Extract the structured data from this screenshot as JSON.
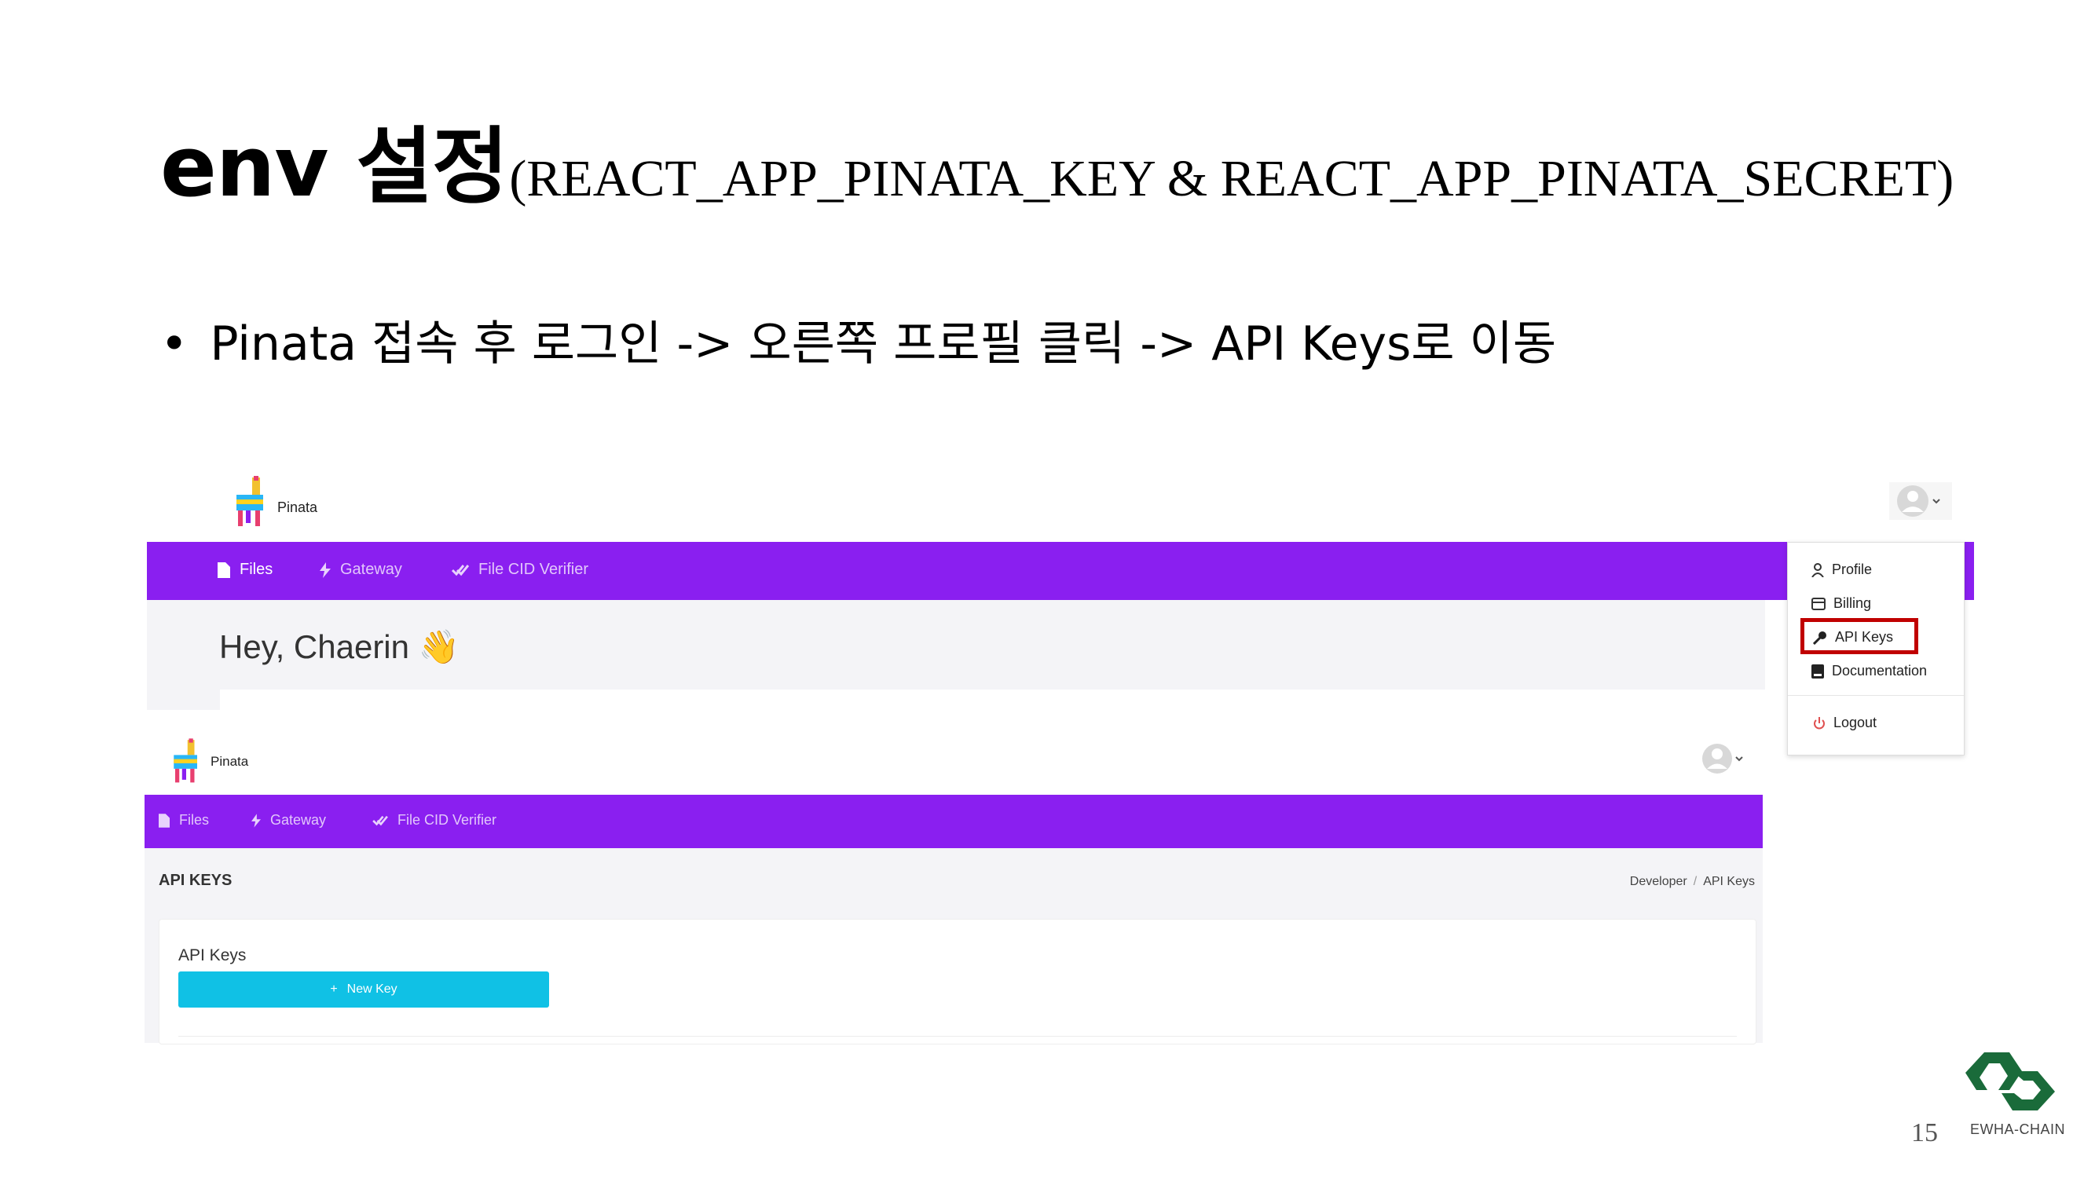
{
  "slide": {
    "title_main": "env 설정",
    "title_sub": "(REACT_APP_PINATA_KEY & REACT_APP_PINATA_SECRET)",
    "bullet_symbol": "•",
    "bullet_text": "Pinata 접속 후 로그인 -> 오른쪽 프로필 클릭 -> API Keys로 이동",
    "page_number": "15",
    "brand": "EWHA-CHAIN"
  },
  "screenshot1": {
    "brand": "Pinata",
    "nav": [
      {
        "label": "Files",
        "icon": "file-icon"
      },
      {
        "label": "Gateway",
        "icon": "bolt-icon"
      },
      {
        "label": "File CID Verifier",
        "icon": "check-double-icon"
      }
    ],
    "greeting": "Hey, Chaerin",
    "greeting_emoji": "👋",
    "dropdown": [
      {
        "label": "Profile",
        "icon": "user-icon"
      },
      {
        "label": "Billing",
        "icon": "card-icon"
      },
      {
        "label": "API Keys",
        "icon": "key-icon"
      },
      {
        "label": "Documentation",
        "icon": "book-icon"
      },
      {
        "label": "Logout",
        "icon": "power-icon"
      }
    ]
  },
  "screenshot2": {
    "brand": "Pinata",
    "nav": [
      {
        "label": "Files",
        "icon": "file-icon"
      },
      {
        "label": "Gateway",
        "icon": "bolt-icon"
      },
      {
        "label": "File CID Verifier",
        "icon": "check-double-icon"
      }
    ],
    "page_title": "API KEYS",
    "breadcrumb": [
      "Developer",
      "/",
      "API Keys"
    ],
    "card_title": "API Keys",
    "new_key_button": "New Key",
    "new_key_plus": "+"
  },
  "colors": {
    "nav_purple": "#8a1ff0",
    "button_cyan": "#10c1e5",
    "highlight_red": "#c00000",
    "logo_green": "#1a6b3a"
  }
}
